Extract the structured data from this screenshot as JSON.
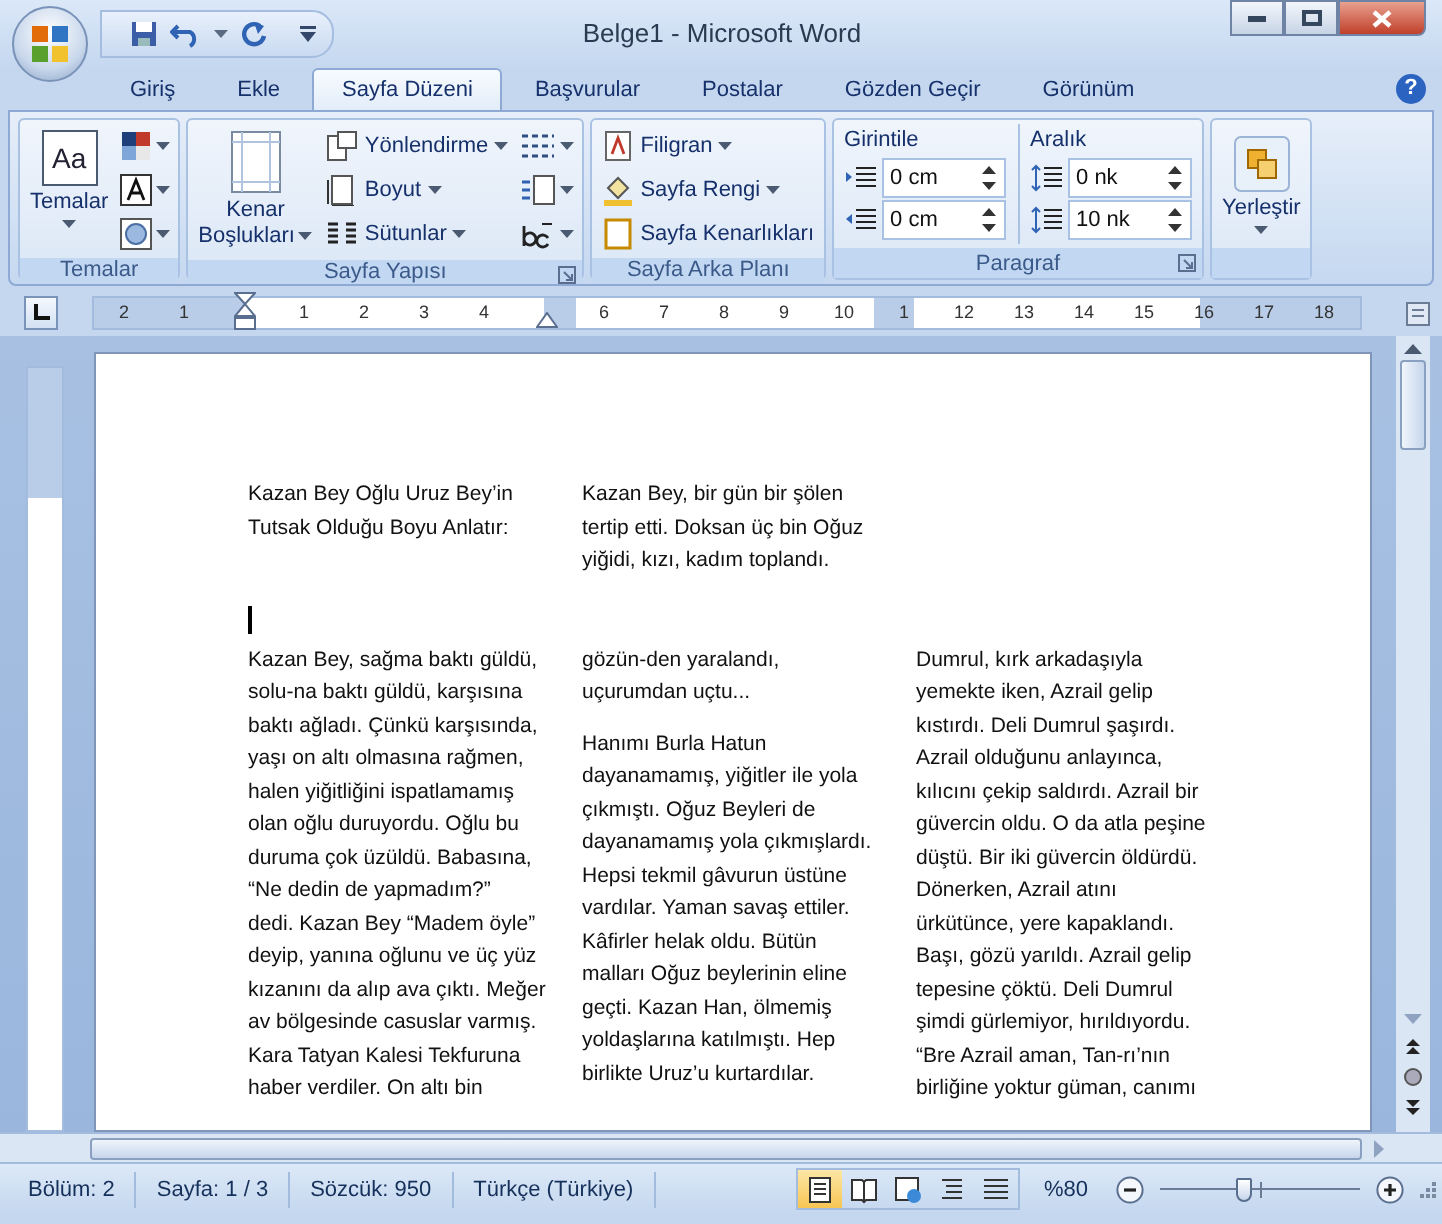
{
  "window": {
    "title": "Belge1 - Microsoft Word"
  },
  "tabs": [
    {
      "label": "Giriş",
      "selected": false
    },
    {
      "label": "Ekle",
      "selected": false
    },
    {
      "label": "Sayfa Düzeni",
      "selected": true
    },
    {
      "label": "Başvurular",
      "selected": false
    },
    {
      "label": "Postalar",
      "selected": false
    },
    {
      "label": "Gözden Geçir",
      "selected": false
    },
    {
      "label": "Görünüm",
      "selected": false
    }
  ],
  "help_glyph": "?",
  "ribbon": {
    "groups": [
      {
        "kind": "themes",
        "name": "Temalar",
        "icon_text": "Aa",
        "big_label": "Temalar",
        "launcher": false
      },
      {
        "kind": "page_setup",
        "name": "Sayfa Yapısı",
        "big_label_lines": [
          "Kenar",
          "Boşlukları"
        ],
        "items": [
          {
            "label": "Yönlendirme",
            "dropdown": true
          },
          {
            "label": "Boyut",
            "dropdown": true
          },
          {
            "label": "Sütunlar",
            "dropdown": true
          }
        ],
        "launcher": true
      },
      {
        "kind": "background",
        "name": "Sayfa Arka Planı",
        "items": [
          {
            "label": "Filigran",
            "dropdown": true
          },
          {
            "label": "Sayfa Rengi",
            "dropdown": true
          },
          {
            "label": "Sayfa Kenarlıkları",
            "dropdown": false
          }
        ],
        "launcher": false
      },
      {
        "kind": "paragraph",
        "name": "Paragraf",
        "indent": {
          "label": "Girintile",
          "fields": [
            "0 cm",
            "0 cm"
          ]
        },
        "spacing": {
          "label": "Aralık",
          "fields": [
            "0 nk",
            "10 nk"
          ]
        },
        "launcher": true
      },
      {
        "kind": "arrange",
        "big_label": "Yerleştir",
        "launcher": false
      }
    ]
  },
  "ruler": {
    "left_numbers": [
      "2",
      "1"
    ],
    "right_numbers": [
      "1",
      "2",
      "3",
      "4"
    ],
    "right_numbers_past_marker": [
      "6",
      "7",
      "8",
      "9",
      "10",
      "1",
      "12",
      "13",
      "14",
      "15",
      "16",
      "17",
      "18"
    ]
  },
  "document": {
    "sections": [
      {
        "columns": [
          [
            {
              "lines": [
                "Kazan Bey Oğlu Uruz Bey’in",
                "Tutsak Olduğu Boyu Anlatır:"
              ]
            }
          ],
          [
            {
              "lines": [
                "Kazan Bey, bir gün bir şölen",
                "tertip etti. Doksan üç bin Oğuz",
                "yiğidi, kızı, kadım toplandı."
              ]
            }
          ]
        ]
      },
      {
        "columns": [
          [
            {
              "lines": [
                "Kazan Bey, sağma baktı güldü,",
                "solu-na baktı güldü, karşısına",
                "baktı ağladı. Çünkü karşısında,",
                "yaşı on altı olmasına rağmen,",
                "halen yiğitliğini ispatlamamış",
                "olan oğlu duruyordu.  Oğlu bu",
                "duruma çok üzüldü. Babasına,",
                "“Ne dedin de yapmadım?”",
                "dedi. Kazan Bey “Madem öyle”",
                "deyip, yanına oğlunu ve üç yüz",
                "kızanını da alıp ava çıktı. Meğer",
                "av bölgesinde casuslar varmış.",
                "Kara Tatyan Kalesi Tekfuruna",
                "haber verdiler. On altı bin"
              ]
            }
          ],
          [
            {
              "lines": [
                "gözün-den yaralandı,",
                "uçurumdan uçtu..."
              ]
            },
            {
              "lines": [
                "Hanımı Burla Hatun",
                "dayanamamış, yiğitler ile yola",
                "çıkmıştı. Oğuz Beyleri de",
                "dayanamamış yola çıkmışlardı.",
                "Hepsi tekmil gâvurun üstüne",
                "vardılar. Yaman savaş ettiler.",
                "Kâfirler helak oldu. Bütün",
                "malları Oğuz beylerinin eline",
                "geçti. Kazan Han, ölmemiş",
                "yoldaşlarına katılmıştı. Hep",
                "birlikte Uruz’u kurtardılar."
              ]
            }
          ],
          [
            {
              "lines": [
                "Dumrul, kırk arkadaşıyla",
                "yemekte iken, Azrail gelip",
                "kıstırdı. Deli Dumrul şaşırdı.",
                "Azrail olduğunu anlayınca,",
                "kılıcını çekip saldırdı. Azrail bir",
                "güvercin oldu. O da atla peşine",
                "düştü. Bir iki güvercin öldürdü.",
                "Dönerken, Azrail atını",
                "ürkütünce, yere kapaklandı.",
                "Başı, gözü yarıldı. Azrail gelip",
                "tepesine çöktü. Deli Dumrul",
                "şimdi gürlemiyor, hırıldıyordu.",
                "“Bre Azrail aman, Tan-rı’nın",
                "birliğine yoktur güman, canımı"
              ]
            }
          ]
        ]
      }
    ]
  },
  "status_bar": {
    "items": [
      "Bölüm: 2",
      "Sayfa: 1 / 3",
      "Sözcük: 950",
      "Türkçe (Türkiye)"
    ],
    "views": [
      {
        "kind": "print",
        "selected": true
      },
      {
        "kind": "reading",
        "selected": false
      },
      {
        "kind": "web",
        "selected": false
      },
      {
        "kind": "outline",
        "selected": false
      },
      {
        "kind": "draft",
        "selected": false
      }
    ],
    "zoom": {
      "label": "%80",
      "level": 0.42
    }
  }
}
